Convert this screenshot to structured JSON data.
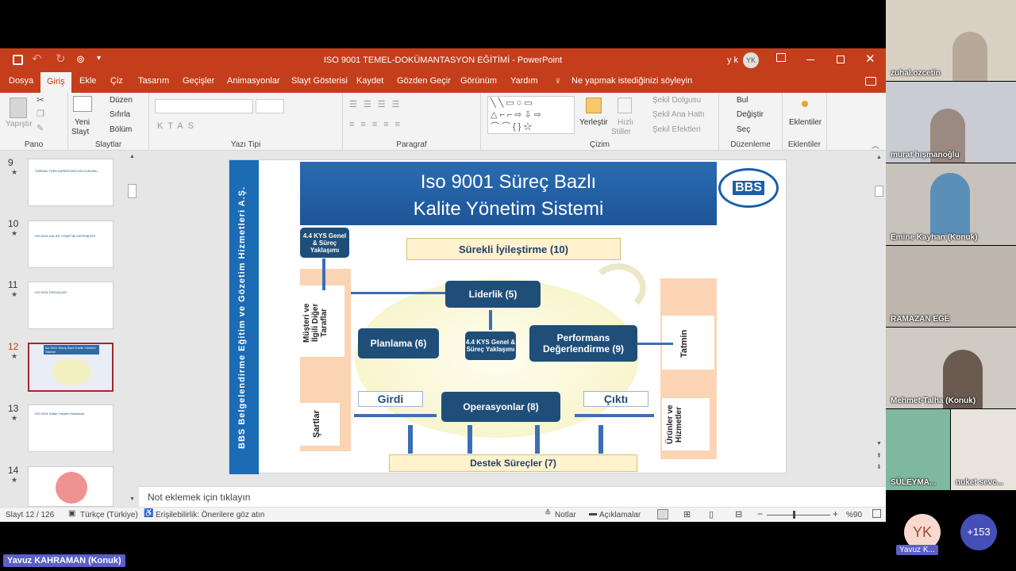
{
  "window": {
    "title": "ISO 9001 TEMEL-DOKÜMANTASYON EĞİTİMİ  -  PowerPoint",
    "user": "y k",
    "user_initials": "YK"
  },
  "tabs": [
    "Dosya",
    "Giriş",
    "Ekle",
    "Çiz",
    "Tasarım",
    "Geçişler",
    "Animasyonlar",
    "Slayt Gösterisi",
    "Kaydet",
    "Gözden Geçir",
    "Görünüm",
    "Yardım"
  ],
  "tell_me": "Ne yapmak istediğinizi söyleyin",
  "ribbon": {
    "pano": {
      "label": "Pano",
      "yapistir": "Yapıştır"
    },
    "slaytlar": {
      "label": "Slaytlar",
      "yeni_slayt": "Yeni",
      "yeni_slayt2": "Slayt",
      "duzen": "Düzen",
      "sifirla": "Sıfırla",
      "bolum": "Bölüm"
    },
    "yazi_tipi": {
      "label": "Yazı Tipi"
    },
    "paragraf": {
      "label": "Paragraf"
    },
    "cizim": {
      "label": "Çizim",
      "yerlestir": "Yerleştir",
      "hizli": "Hızlı",
      "stiller": "Stiller",
      "sekil_dolgusu": "Şekil Dolgusu",
      "sekil_ana_hatti": "Şekil Ana Hattı",
      "sekil_efektleri": "Şekil Efektleri"
    },
    "duzenleme": {
      "label": "Düzenleme",
      "bul": "Bul",
      "degistir": "Değiştir",
      "sec": "Seç"
    },
    "eklentiler": {
      "label": "Eklentiler",
      "btn": "Eklentiler"
    }
  },
  "thumbnails": [
    {
      "num": "9",
      "title": "TÜRKAK  TÜRK AKREDİTASYON KURUMU"
    },
    {
      "num": "10",
      "title": "ISO 9001 KALİTE YÖNETİM SİSTEMLERİ"
    },
    {
      "num": "11",
      "title": "ISO 9001 FAYDALARI"
    },
    {
      "num": "12",
      "title": "Iso 9001 Süreç Bazlı Kalite Yönetim Sistemi"
    },
    {
      "num": "13",
      "title": "ISO 9001 Kalite Yönetim Standardı"
    },
    {
      "num": "14",
      "title": ""
    }
  ],
  "slide": {
    "vertical_title": "BBS Belgelendirme Eğitim ve Gözetim Hizmetleri A.Ş.",
    "title_line1": "Iso 9001 Süreç Bazlı",
    "title_line2": "Kalite Yönetim Sistemi",
    "logo": "BBS",
    "kys_top": "4.4 KYS Genel & Süreç Yaklaşımı",
    "surekli": "Sürekli İyileştirme (10)",
    "liderlik": "Liderlik (5)",
    "planlama": "Planlama (6)",
    "kys_center": "4.4 KYS Genel & Süreç Yaklaşımı",
    "performans": "Performans Değerlendirme (9)",
    "operasyonlar": "Operasyonlar (8)",
    "girdi": "Girdi",
    "cikti": "Çıktı",
    "destek": "Destek Süreçler (7)",
    "musteri": "Müşteri ve İlgili Diğer Taraflar",
    "sartlar": "Şartlar",
    "tatmin": "Tatmin",
    "urunler": "Ürünler ve Hizmetler"
  },
  "notes_placeholder": "Not eklemek için tıklayın",
  "status": {
    "slide": "Slayt 12 / 126",
    "language": "Türkçe (Türkiye)",
    "accessibility": "Erişilebilirlik: Önerilere göz atın",
    "notes": "Notlar",
    "comments": "Açıklamalar",
    "zoom": "%90"
  },
  "participants": [
    {
      "name": "zuhal.ozcetin",
      "bg": "#d9d2c4"
    },
    {
      "name": "murat hışmanoğlu",
      "bg": "#c9ccd2"
    },
    {
      "name": "Emine Kayhan (Konuk)",
      "bg": "#c7c2bc"
    },
    {
      "name": "RAMAZAN EGE",
      "bg": "#bfb7ad"
    },
    {
      "name": "Mehmet-Talha (Konuk)",
      "bg": "#cfcac2"
    },
    {
      "name": "SÜLEYMA...",
      "bg": "#7fb8a0"
    },
    {
      "name": "nuket sevc...",
      "bg": "#e8e4dc"
    }
  ],
  "self": {
    "initials": "YK",
    "name": "Yavuz K..."
  },
  "more_count": "+153",
  "presenter_label": "Yavuz KAHRAMAN (Konuk)"
}
